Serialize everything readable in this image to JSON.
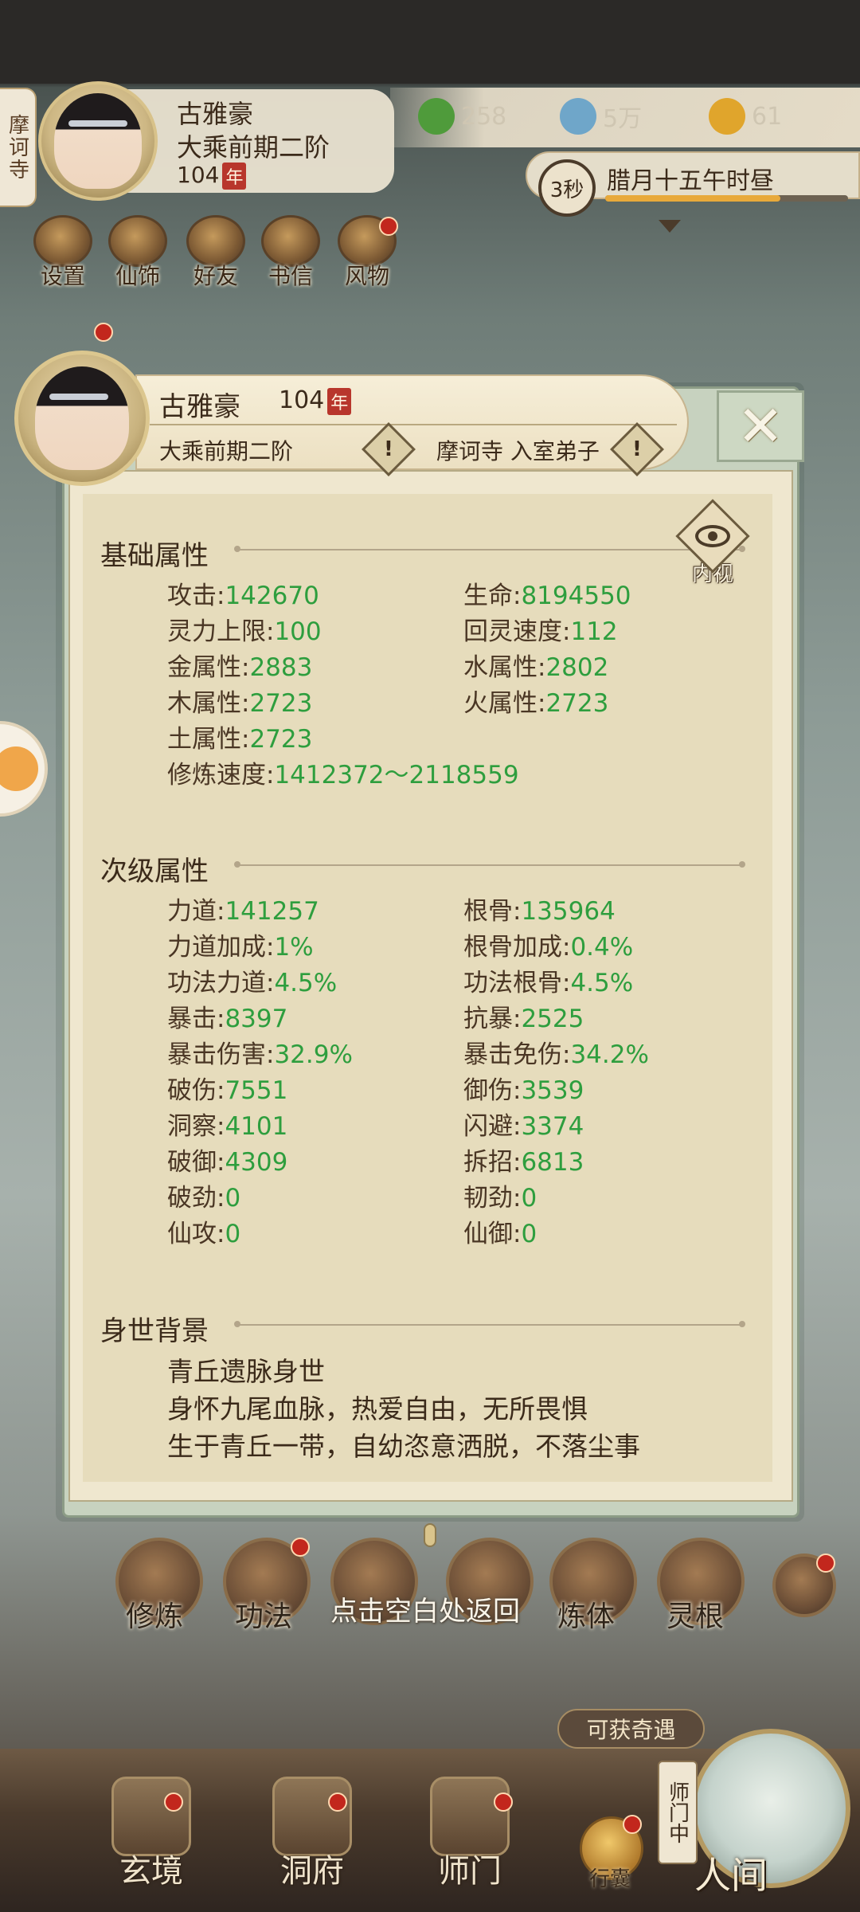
{
  "header": {
    "temple": "摩诃寺",
    "name": "古雅豪",
    "realm": "大乘前期二阶",
    "age": "104",
    "age_unit": "年"
  },
  "resources": [
    {
      "icon": "jade-leaf-icon",
      "value": "258",
      "color": "#4f9b3b"
    },
    {
      "icon": "coin-icon",
      "value": "5万",
      "color": "#6fa6c9"
    },
    {
      "icon": "gold-ingot-icon",
      "value": "61",
      "color": "#e0a52c"
    }
  ],
  "time": {
    "countdown": "3秒",
    "label": "腊月十五午时昼",
    "progress": 0.72
  },
  "menu": [
    {
      "label": "设置",
      "icon": "settings-icon",
      "dot": false
    },
    {
      "label": "仙饰",
      "icon": "costume-icon",
      "dot": false
    },
    {
      "label": "好友",
      "icon": "friends-icon",
      "dot": false
    },
    {
      "label": "书信",
      "icon": "letter-icon",
      "dot": false
    },
    {
      "label": "风物",
      "icon": "scenery-icon",
      "dot": true
    }
  ],
  "panel": {
    "name": "古雅豪",
    "age": "104",
    "age_unit": "年",
    "realm": "大乘前期二阶",
    "sect": "摩诃寺 入室弟子",
    "warn": "!",
    "close": "✕",
    "inner_view": "内视",
    "basic_title": "基础属性",
    "basic": [
      {
        "label": "攻击",
        "value": "142670"
      },
      {
        "label": "生命",
        "value": "8194550"
      },
      {
        "label": "灵力上限",
        "value": "100"
      },
      {
        "label": "回灵速度",
        "value": "112"
      },
      {
        "label": "金属性",
        "value": "2883"
      },
      {
        "label": "水属性",
        "value": "2802"
      },
      {
        "label": "木属性",
        "value": "2723"
      },
      {
        "label": "火属性",
        "value": "2723"
      },
      {
        "label": "土属性",
        "value": "2723"
      },
      {
        "label": "修炼速度",
        "value": "1412372～2118559"
      }
    ],
    "secondary_title": "次级属性",
    "secondary": [
      {
        "label": "力道",
        "value": "141257"
      },
      {
        "label": "根骨",
        "value": "135964"
      },
      {
        "label": "力道加成",
        "value": "1%"
      },
      {
        "label": "根骨加成",
        "value": "0.4%"
      },
      {
        "label": "功法力道",
        "value": "4.5%"
      },
      {
        "label": "功法根骨",
        "value": "4.5%"
      },
      {
        "label": "暴击",
        "value": "8397"
      },
      {
        "label": "抗暴",
        "value": "2525"
      },
      {
        "label": "暴击伤害",
        "value": "32.9%"
      },
      {
        "label": "暴击免伤",
        "value": "34.2%"
      },
      {
        "label": "破伤",
        "value": "7551"
      },
      {
        "label": "御伤",
        "value": "3539"
      },
      {
        "label": "洞察",
        "value": "4101"
      },
      {
        "label": "闪避",
        "value": "3374"
      },
      {
        "label": "破御",
        "value": "4309"
      },
      {
        "label": "拆招",
        "value": "6813"
      },
      {
        "label": "破劲",
        "value": "0"
      },
      {
        "label": "韧劲",
        "value": "0"
      },
      {
        "label": "仙攻",
        "value": "0"
      },
      {
        "label": "仙御",
        "value": "0"
      }
    ],
    "background_title": "身世背景",
    "background": [
      "青丘遗脉身世",
      "身怀九尾血脉，热爱自由，无所畏惧",
      "生于青丘一带，自幼恣意洒脱，不落尘事"
    ]
  },
  "skills": [
    {
      "label": "修炼",
      "dot": false
    },
    {
      "label": "功法",
      "dot": true
    },
    {
      "label": "",
      "dot": true
    },
    {
      "label": "",
      "dot": false
    },
    {
      "label": "炼体",
      "dot": false
    },
    {
      "label": "灵根",
      "dot": true
    }
  ],
  "return_hint": "点击空白处返回",
  "chance": "可获奇遇",
  "bottom_nav": [
    {
      "label": "玄境",
      "dot": true
    },
    {
      "label": "洞府",
      "dot": true
    },
    {
      "label": "师门",
      "dot": true
    }
  ],
  "bag": "行囊",
  "shimen_tag": "师门中",
  "world": "人间"
}
